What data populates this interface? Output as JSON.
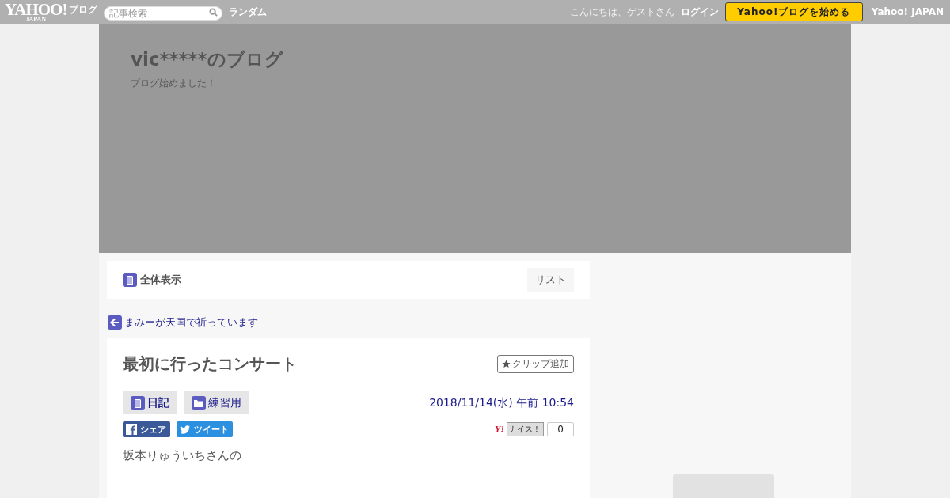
{
  "topbar": {
    "logo": {
      "main": "YAHOO!",
      "sub": "JAPAN",
      "service": "ブログ"
    },
    "search": {
      "placeholder": "記事検索"
    },
    "random_link": "ランダム",
    "greeting": "こんにちは、ゲストさん",
    "login": "ログイン",
    "start_button": "Yahoo!ブログを始める",
    "portal_link": "Yahoo! JAPAN"
  },
  "header": {
    "title": "vic*****のブログ",
    "subtitle": "ブログ始めました！"
  },
  "nav": {
    "all_view": "全体表示",
    "list_button": "リスト"
  },
  "prev_post": "まみーが天国で祈っています",
  "article": {
    "title": "最初に行ったコンサート",
    "clip_button": "クリップ追加",
    "tags": [
      {
        "kind": "category",
        "label": "日記"
      },
      {
        "kind": "folder",
        "label": "練習用"
      }
    ],
    "date": "2018/11/14(水) 午前 10:54",
    "share": [
      {
        "kind": "facebook",
        "label": "シェア"
      },
      {
        "kind": "twitter",
        "label": "ツイート"
      }
    ],
    "nice": {
      "logo": "Y!",
      "label": "ナイス！",
      "count": "0"
    },
    "body": "坂本りゅういちさんの"
  }
}
